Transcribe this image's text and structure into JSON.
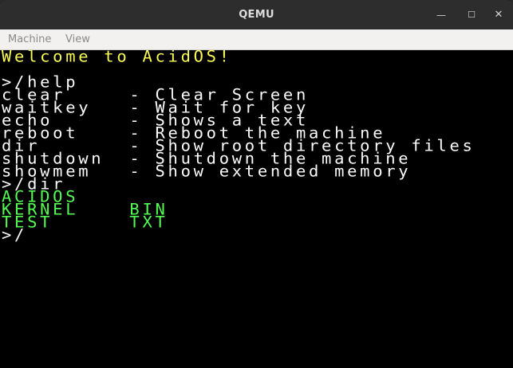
{
  "window": {
    "title": "QEMU",
    "minimize_glyph": "—",
    "maximize_glyph": "☐",
    "close_glyph": "✕"
  },
  "menubar": {
    "items": [
      "Machine",
      "View"
    ]
  },
  "terminal": {
    "colors": {
      "yellow": "#fcfc54",
      "white": "#fcfcfc",
      "green": "#54fc54",
      "background": "#000000"
    },
    "lines": [
      {
        "text": "Welcome to AcidOS!",
        "color": "yellow"
      },
      {
        "text": "",
        "color": "white"
      },
      {
        "text": ">/help",
        "color": "white"
      },
      {
        "text": "clear     - Clear Screen",
        "color": "white"
      },
      {
        "text": "waitkey   - Wait for key",
        "color": "white"
      },
      {
        "text": "echo      - Shows a text",
        "color": "white"
      },
      {
        "text": "reboot    - Reboot the machine",
        "color": "white"
      },
      {
        "text": "dir       - Show root directory files",
        "color": "white"
      },
      {
        "text": "shutdown  - Shutdown the machine",
        "color": "white"
      },
      {
        "text": "showmem   - Show extended memory",
        "color": "white"
      },
      {
        "text": ">/dir",
        "color": "white"
      },
      {
        "text": "ACIDOS",
        "color": "green"
      },
      {
        "text": "KERNEL    BIN",
        "color": "green"
      },
      {
        "text": "TEST      TXT",
        "color": "green"
      },
      {
        "text": ">/",
        "color": "white"
      }
    ]
  }
}
